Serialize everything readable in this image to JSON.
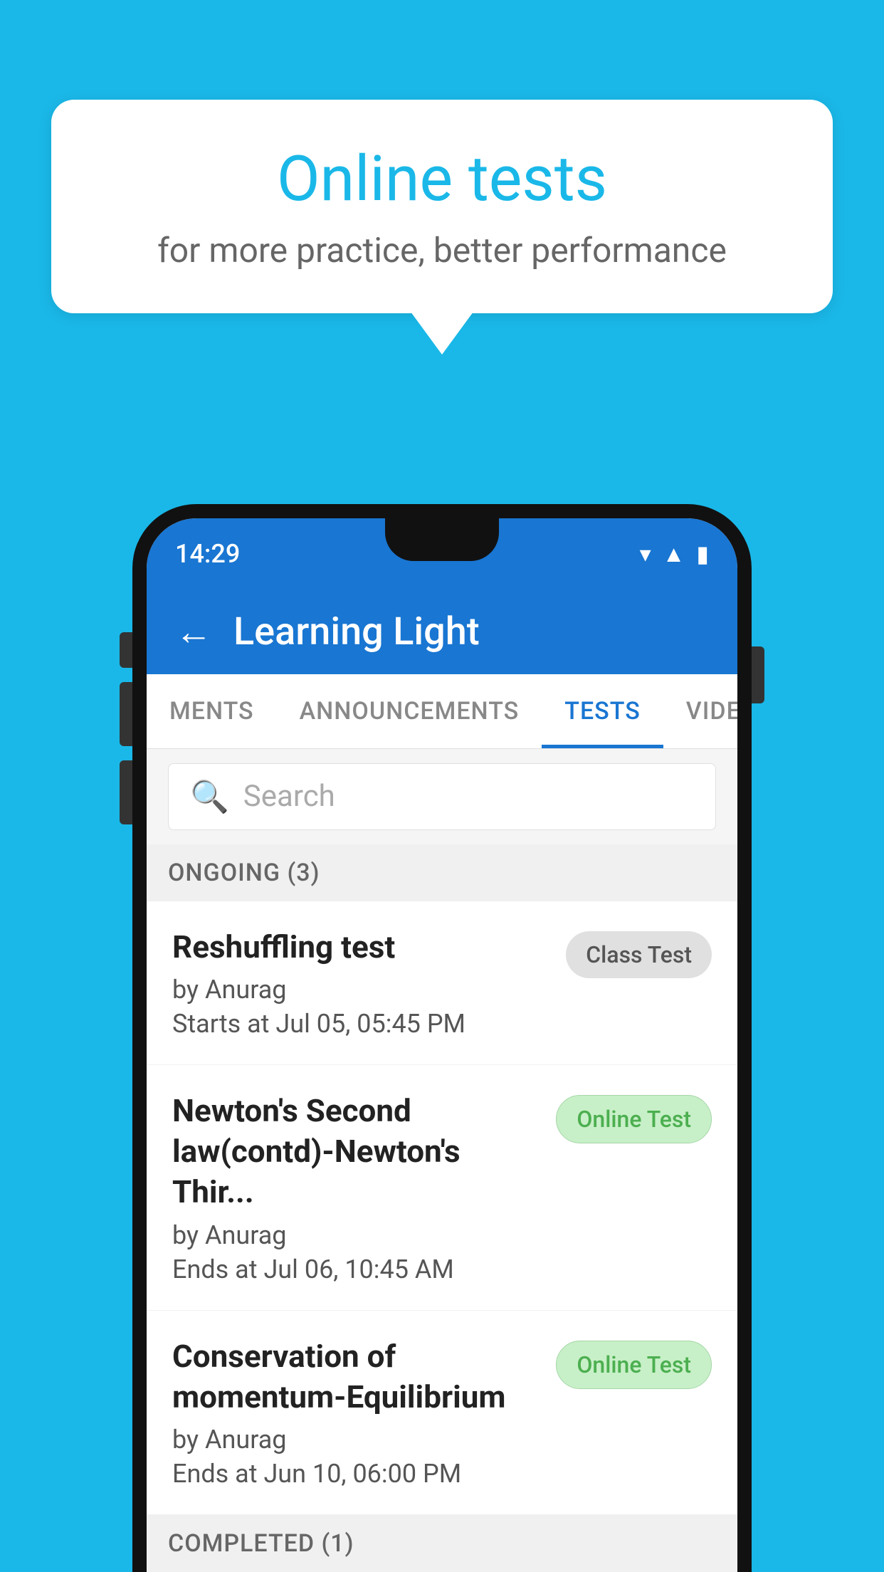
{
  "background_color": "#1ab8e8",
  "speech_bubble": {
    "title": "Online tests",
    "subtitle": "for more practice, better performance"
  },
  "phone": {
    "status_bar": {
      "time": "14:29"
    },
    "app_header": {
      "title": "Learning Light",
      "back_label": "←"
    },
    "tabs": [
      {
        "label": "MENTS",
        "active": false
      },
      {
        "label": "ANNOUNCEMENTS",
        "active": false
      },
      {
        "label": "TESTS",
        "active": true
      },
      {
        "label": "VIDEOS",
        "active": false
      }
    ],
    "search": {
      "placeholder": "Search"
    },
    "ongoing_section": {
      "label": "ONGOING (3)"
    },
    "tests": [
      {
        "name": "Reshuffling test",
        "by": "by Anurag",
        "date": "Starts at  Jul 05, 05:45 PM",
        "badge": "Class Test",
        "badge_type": "class"
      },
      {
        "name": "Newton's Second law(contd)-Newton's Thir...",
        "by": "by Anurag",
        "date": "Ends at  Jul 06, 10:45 AM",
        "badge": "Online Test",
        "badge_type": "online"
      },
      {
        "name": "Conservation of momentum-Equilibrium",
        "by": "by Anurag",
        "date": "Ends at  Jun 10, 06:00 PM",
        "badge": "Online Test",
        "badge_type": "online"
      }
    ],
    "completed_section": {
      "label": "COMPLETED (1)"
    }
  }
}
